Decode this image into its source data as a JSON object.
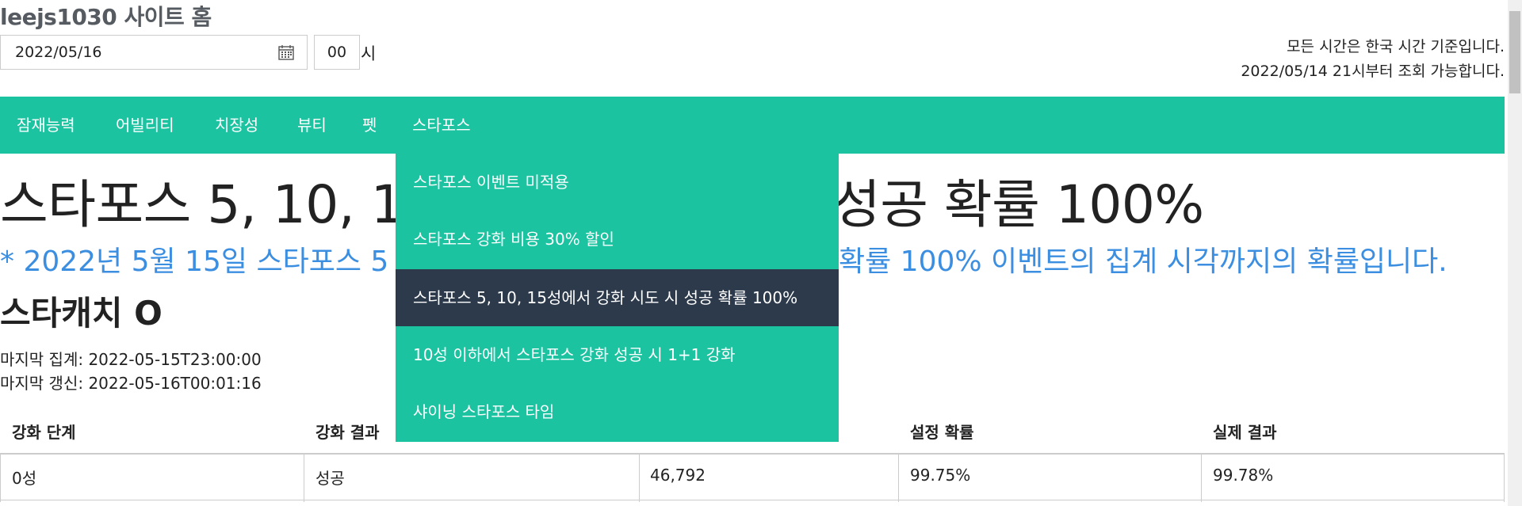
{
  "site": {
    "title": "leejs1030 사이트 홈"
  },
  "controls": {
    "date_value": "2022/05/16",
    "hour_value": "00",
    "hour_unit": "시",
    "tz_line1": "모든 시간은 한국 시간 기준입니다.",
    "tz_line2": "2022/05/14 21시부터 조회 가능합니다."
  },
  "nav": {
    "items": [
      {
        "label": "잠재능력"
      },
      {
        "label": "어빌리티"
      },
      {
        "label": "치장성"
      },
      {
        "label": "뷰티"
      },
      {
        "label": "펫"
      },
      {
        "label": "스타포스"
      }
    ]
  },
  "dropdown": {
    "items": [
      {
        "label": "스타포스 이벤트 미적용"
      },
      {
        "label": "스타포스 강화 비용 30% 할인"
      },
      {
        "label": "스타포스 5, 10, 15성에서 강화 시도 시 성공 확률 100%"
      },
      {
        "label": "10성 이하에서 스타포스 강화 성공 시 1+1 강화"
      },
      {
        "label": "샤이닝 스타포스 타임"
      }
    ],
    "active_index": 2
  },
  "page": {
    "heading_visible_left": "스타포스 5, 10, 15성",
    "heading_visible_right": "성공 확률 100%",
    "note_visible_left": "* 2022년 5월 15일 스타포스 5",
    "note_visible_right": "확률 100% 이벤트의 집계 시각까지의 확률입니다.",
    "starcatch": "스타캐치 O",
    "last_aggregate": "마지막 집계: 2022-05-15T23:00:00",
    "last_update": "마지막 갱신: 2022-05-16T00:01:16"
  },
  "table": {
    "headers": [
      "강화 단계",
      "강화 결과",
      "",
      "설정 확률",
      "실제 결과"
    ],
    "rows": [
      [
        "0성",
        "성공",
        "46,792",
        "99.75%",
        "99.78%"
      ]
    ]
  },
  "colors": {
    "accent": "#1bc3a0",
    "active_menu": "#2c3a4b",
    "note_blue": "#3b8ee0"
  }
}
